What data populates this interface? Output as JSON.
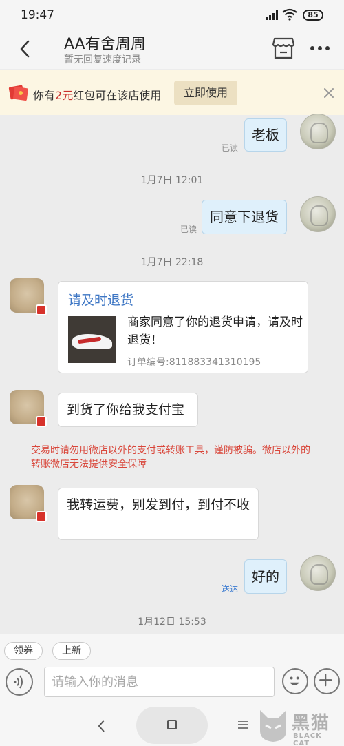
{
  "status_bar": {
    "time": "19:47",
    "battery": "85"
  },
  "header": {
    "title": "AA有舍周周",
    "subtitle": "暂无回复速度记录"
  },
  "coupon": {
    "prefix": "你有",
    "amount": "2元",
    "suffix": "红包可在该店使用",
    "button_label": "立即使用"
  },
  "messages": {
    "m1": {
      "text": "老板",
      "status": "已读"
    },
    "t1": "1月7日 12:01",
    "m2": {
      "text": "同意下退货",
      "status": "已读"
    },
    "t2": "1月7日 22:18",
    "card": {
      "title": "请及时退货",
      "description": "商家同意了你的退货申请，请及时退货！",
      "order": "订单编号:811883341310195"
    },
    "m3": {
      "text": "到货了你给我支付宝"
    },
    "warning": "交易时请勿用微店以外的支付或转账工具，谨防被骗。微店以外的转账微店无法提供安全保障",
    "m4": {
      "text": "我转运费，别发到付，到付不收"
    },
    "m5": {
      "text": "好的",
      "status": "送达"
    },
    "t3": "1月12日 15:53"
  },
  "quick_replies": {
    "coupon": "领券",
    "new": "上新"
  },
  "input": {
    "placeholder": "请输入你的消息"
  },
  "watermark": {
    "cn": "黑猫",
    "en": "BLACK CAT"
  },
  "colors": {
    "bubble_out": "#dff0fb",
    "link_blue": "#3d76c4",
    "warning_red": "#d9463a",
    "coupon_bg": "#fcf6e3"
  },
  "icons": [
    "back-icon",
    "store-icon",
    "more-icon",
    "redpacket-icon",
    "close-icon",
    "voice-icon",
    "emoji-icon",
    "plus-icon"
  ]
}
